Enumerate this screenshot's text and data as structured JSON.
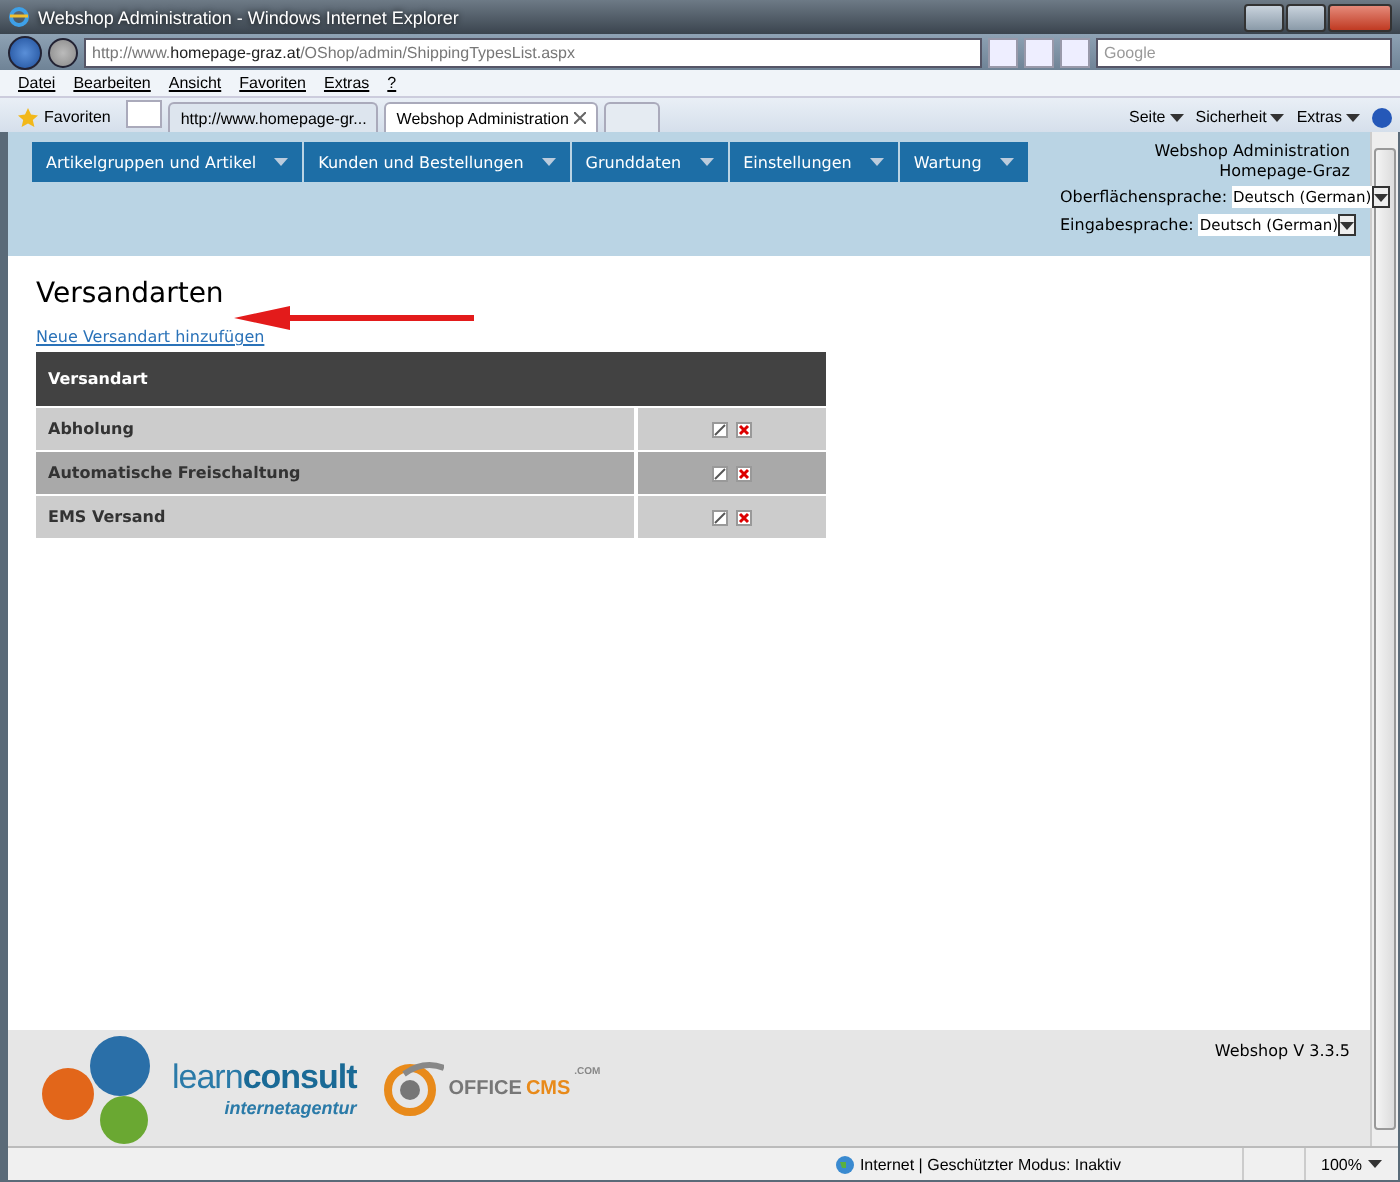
{
  "window": {
    "title": "Webshop Administration - Windows Internet Explorer"
  },
  "address_bar": {
    "url": "http://www.**homepage-graz.at**/OShop/admin/ShippingTypesList.aspx"
  },
  "search": {
    "placeholder": "Google"
  },
  "menu_bar": [
    "Datei",
    "Bearbeiten",
    "Ansicht",
    "Favoriten",
    "Extras",
    "?"
  ],
  "favorites": {
    "label": "Favoriten"
  },
  "tabs": [
    {
      "label": "http://www.homepage-gr...",
      "selected": false
    },
    {
      "label": "Webshop Administration",
      "selected": true
    }
  ],
  "command_bar": [
    "Seite",
    "Sicherheit",
    "Extras"
  ],
  "nav": [
    "Artikelgruppen und Artikel",
    "Kunden und Bestellungen",
    "Grunddaten",
    "Einstellungen",
    "Wartung"
  ],
  "header_info": {
    "title": "Webshop Administration",
    "site": "Homepage-Graz"
  },
  "languages": [
    {
      "label": "Oberflächensprache:",
      "value": "Deutsch (German)"
    },
    {
      "label": "Eingabesprache:",
      "value": "Deutsch (German)"
    }
  ],
  "page": {
    "heading": "Versandarten",
    "add_link": "Neue Versandart hinzufügen"
  },
  "table": {
    "columns": [
      "Versandart"
    ],
    "rows": [
      "Abholung",
      "Automatische Freischaltung",
      "EMS Versand"
    ]
  },
  "footer": {
    "version": "Webshop V 3.3.5",
    "learnconsult": "learn**consult**",
    "tagline": "internetagentur",
    "office": "OFFICE",
    "cms": "CMS",
    "dotcom": ".COM"
  },
  "status_bar": {
    "zone": "Internet | Geschützter Modus: Inaktiv",
    "zoom": "100%"
  }
}
